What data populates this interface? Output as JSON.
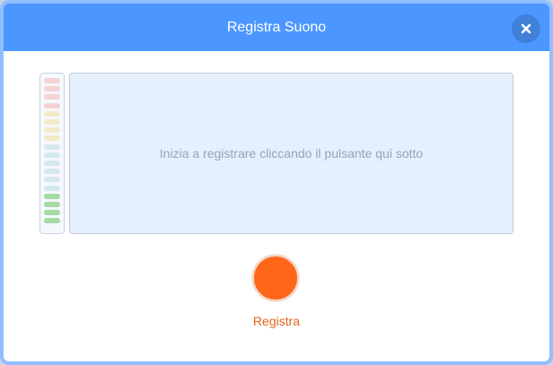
{
  "dialog": {
    "title": "Registra Suono",
    "close_icon": "close-icon"
  },
  "meter": {
    "segments": [
      "#f4d3d3",
      "#f4d3d3",
      "#f4d3d3",
      "#f4d3d3",
      "#f5e9c8",
      "#f5e9c8",
      "#f5e9c8",
      "#f5e9c8",
      "#d5e9ee",
      "#d5e9ee",
      "#d5e9ee",
      "#d5e9ee",
      "#d5e9ee",
      "#d5e9ee",
      "#a8d9a6",
      "#a8d9a6",
      "#a8d9a6",
      "#a8d9a6"
    ]
  },
  "waveform": {
    "hint": "Inizia a registrare cliccando il pulsante qui sotto"
  },
  "record": {
    "label": "Registra",
    "color": "#ff661a"
  },
  "colors": {
    "header": "#4c97ff",
    "accent": "#ff661a"
  }
}
